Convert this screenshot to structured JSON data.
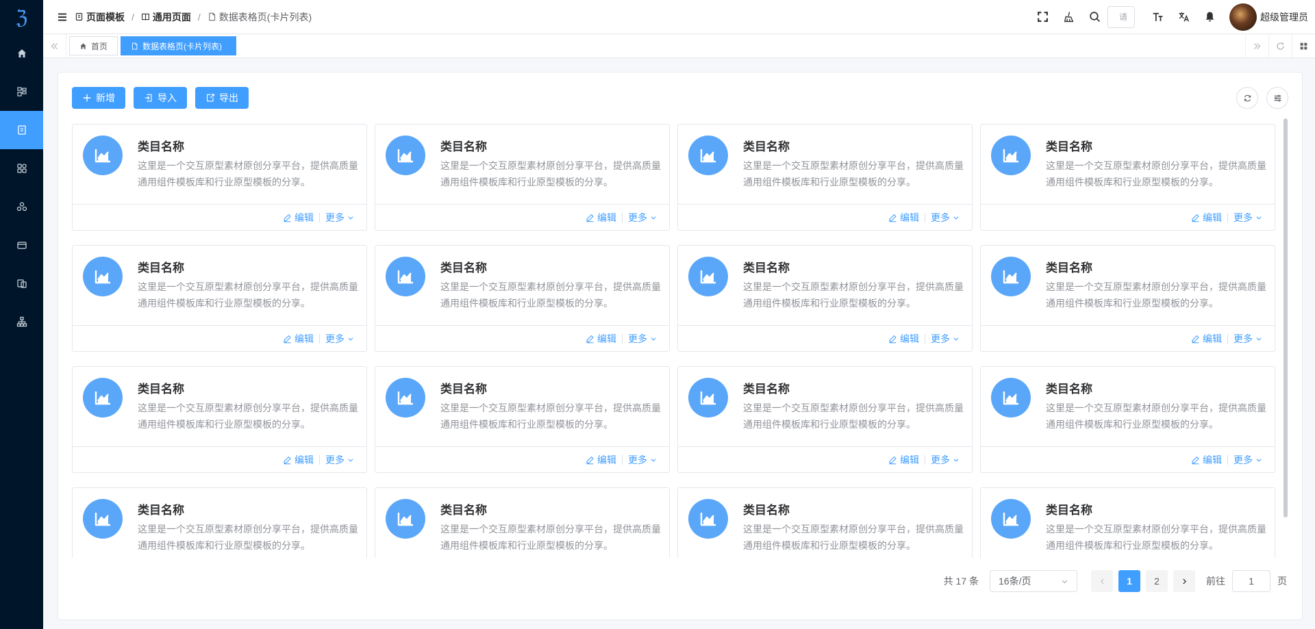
{
  "sidebar": {
    "logo": "ℨ",
    "items": [
      {
        "icon": "home-icon"
      },
      {
        "icon": "structure-icon"
      },
      {
        "icon": "page-icon",
        "active": true
      },
      {
        "icon": "grid-icon"
      },
      {
        "icon": "components-icon"
      },
      {
        "icon": "card-icon"
      },
      {
        "icon": "documents-icon"
      },
      {
        "icon": "org-chart-icon"
      }
    ]
  },
  "header": {
    "breadcrumbs": [
      "页面模板",
      "通用页面",
      "数据表格页(卡片列表)"
    ],
    "search_placeholder": "请",
    "user_name": "超级管理员"
  },
  "tabs": [
    {
      "label": "首页",
      "icon": "home-icon"
    },
    {
      "label": "数据表格页(卡片列表)",
      "icon": "page-icon",
      "active": true
    }
  ],
  "toolbar": {
    "add_label": "新增",
    "import_label": "导入",
    "export_label": "导出"
  },
  "cards": {
    "title": "类目名称",
    "description": "这里是一个交互原型素材原创分享平台，提供高质量通用组件模板库和行业原型模板的分享。",
    "edit_label": "编辑",
    "more_label": "更多",
    "count": 16
  },
  "pagination": {
    "total_label": "共 17 条",
    "page_size": "16条/页",
    "pages": [
      "1",
      "2"
    ],
    "current_page": "1",
    "goto_prefix": "前往",
    "goto_value": "1",
    "goto_suffix": "页"
  },
  "colors": {
    "primary": "#409eff",
    "sidebar_bg": "#001529",
    "card_icon_bg": "#5aa7f9"
  }
}
